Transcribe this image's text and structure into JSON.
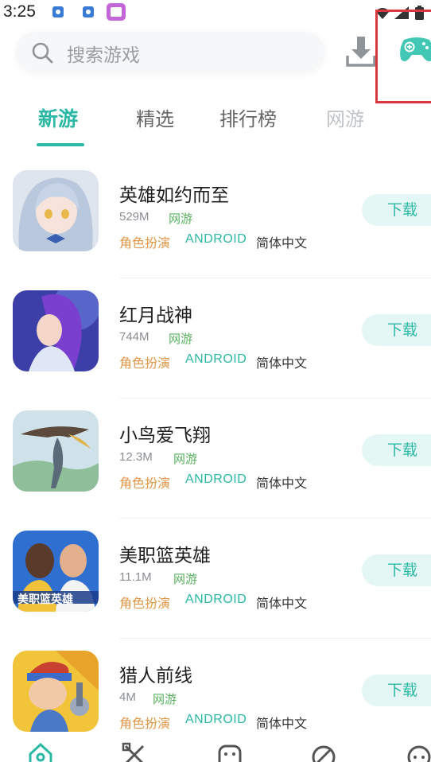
{
  "status_bar": {
    "time": "3:25"
  },
  "search": {
    "placeholder": "搜索游戏"
  },
  "tabs": [
    {
      "label": "新游",
      "active": true
    },
    {
      "label": "精选",
      "active": false
    },
    {
      "label": "排行榜",
      "active": false
    },
    {
      "label": "网游",
      "active": false
    }
  ],
  "games": [
    {
      "name": "英雄如约而至",
      "size": "529M",
      "type": "网游",
      "genre": "角色扮演",
      "platform": "ANDROID",
      "language": "简体中文",
      "button": "下载"
    },
    {
      "name": "红月战神",
      "size": "744M",
      "type": "网游",
      "genre": "角色扮演",
      "platform": "ANDROID",
      "language": "简体中文",
      "button": "下载"
    },
    {
      "name": "小鸟爱飞翔",
      "size": "12.3M",
      "type": "网游",
      "genre": "角色扮演",
      "platform": "ANDROID",
      "language": "简体中文",
      "button": "下载"
    },
    {
      "name": "美职篮英雄",
      "size": "11.1M",
      "type": "网游",
      "genre": "角色扮演",
      "platform": "ANDROID",
      "language": "简体中文",
      "button": "下载"
    },
    {
      "name": "猎人前线",
      "size": "4M",
      "type": "网游",
      "genre": "角色扮演",
      "platform": "ANDROID",
      "language": "简体中文",
      "button": "下载"
    }
  ],
  "icon_logo_text": {
    "game4": "美职篮英雄"
  },
  "colors": {
    "accent": "#2bb8a5",
    "genre_tag": "#e39646",
    "type_tag": "#58b15f",
    "highlight_box": "#d9363e"
  }
}
